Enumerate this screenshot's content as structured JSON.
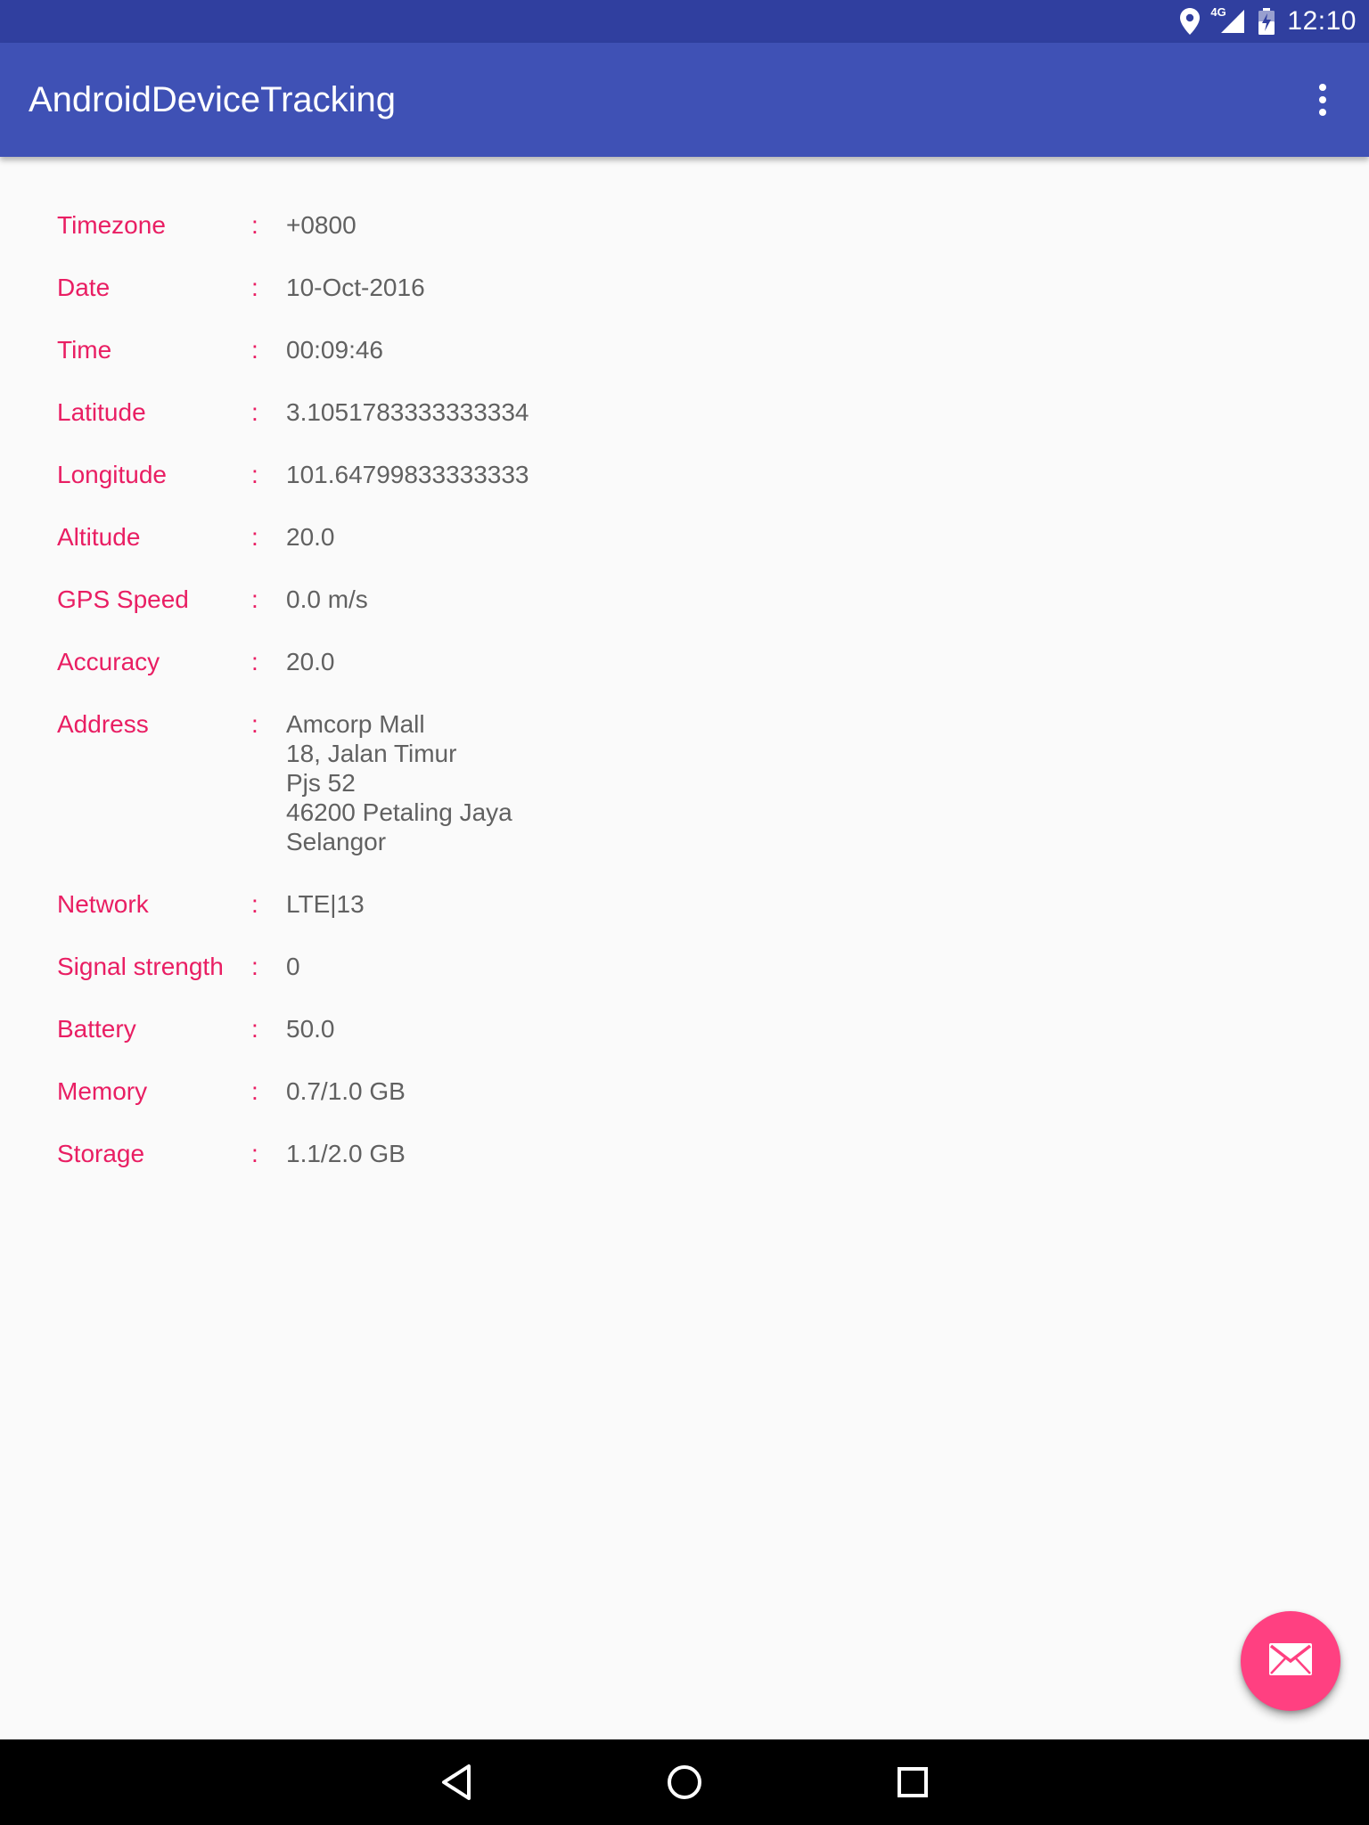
{
  "status_bar": {
    "time": "12:10",
    "network_type": "4G",
    "icons": [
      "location-icon",
      "signal-icon",
      "battery-charging-icon"
    ]
  },
  "app_bar": {
    "title": "AndroidDeviceTracking",
    "menu_icon": "more-vert-icon"
  },
  "info": {
    "separator": ":",
    "rows": [
      {
        "label": "Timezone",
        "value": "+0800"
      },
      {
        "label": "Date",
        "value": "10-Oct-2016"
      },
      {
        "label": "Time",
        "value": "00:09:46"
      },
      {
        "label": "Latitude",
        "value": "3.1051783333333334"
      },
      {
        "label": "Longitude",
        "value": "101.64799833333333"
      },
      {
        "label": "Altitude",
        "value": "20.0"
      },
      {
        "label": "GPS Speed",
        "value": "0.0 m/s"
      },
      {
        "label": "Accuracy",
        "value": "20.0"
      },
      {
        "label": "Address",
        "value": "Amcorp Mall\n18, Jalan Timur\nPjs 52\n46200 Petaling Jaya\nSelangor"
      },
      {
        "label": "Network",
        "value": "LTE|13"
      },
      {
        "label": "Signal strength",
        "value": "0"
      },
      {
        "label": "Battery",
        "value": "50.0"
      },
      {
        "label": "Memory",
        "value": "0.7/1.0 GB"
      },
      {
        "label": "Storage",
        "value": "1.1/2.0 GB"
      }
    ]
  },
  "fab": {
    "icon": "email-icon"
  },
  "nav_bar": {
    "icons": [
      "back-icon",
      "home-icon",
      "recents-icon"
    ]
  },
  "colors": {
    "status_bar": "#303f9f",
    "app_bar": "#3f51b5",
    "label": "#e91e63",
    "value": "#616161",
    "fab": "#ff4081",
    "background": "#fafafa"
  }
}
